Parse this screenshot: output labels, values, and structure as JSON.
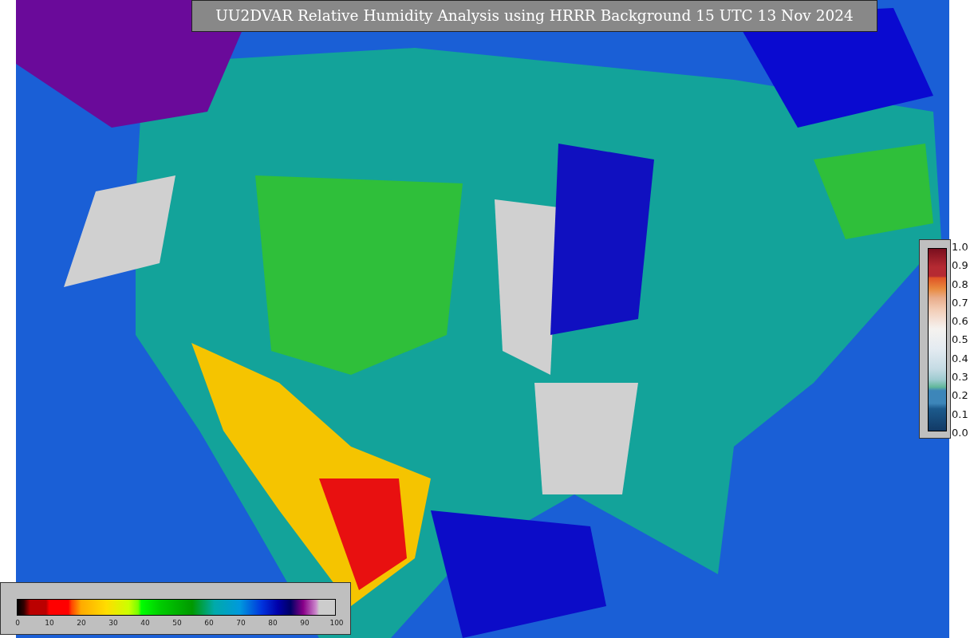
{
  "title": "UU2DVAR Relative Humidity Analysis using HRRR Background 15 UTC 13 Nov 2024",
  "humidity_colorbar": {
    "ticks": [
      "0",
      "10",
      "20",
      "30",
      "40",
      "50",
      "60",
      "70",
      "80",
      "90",
      "100"
    ]
  },
  "station_colorbar": {
    "ticks": [
      "1.0",
      "0.9",
      "0.8",
      "0.7",
      "0.6",
      "0.5",
      "0.4",
      "0.3",
      "0.2",
      "0.1",
      "0.0"
    ]
  }
}
